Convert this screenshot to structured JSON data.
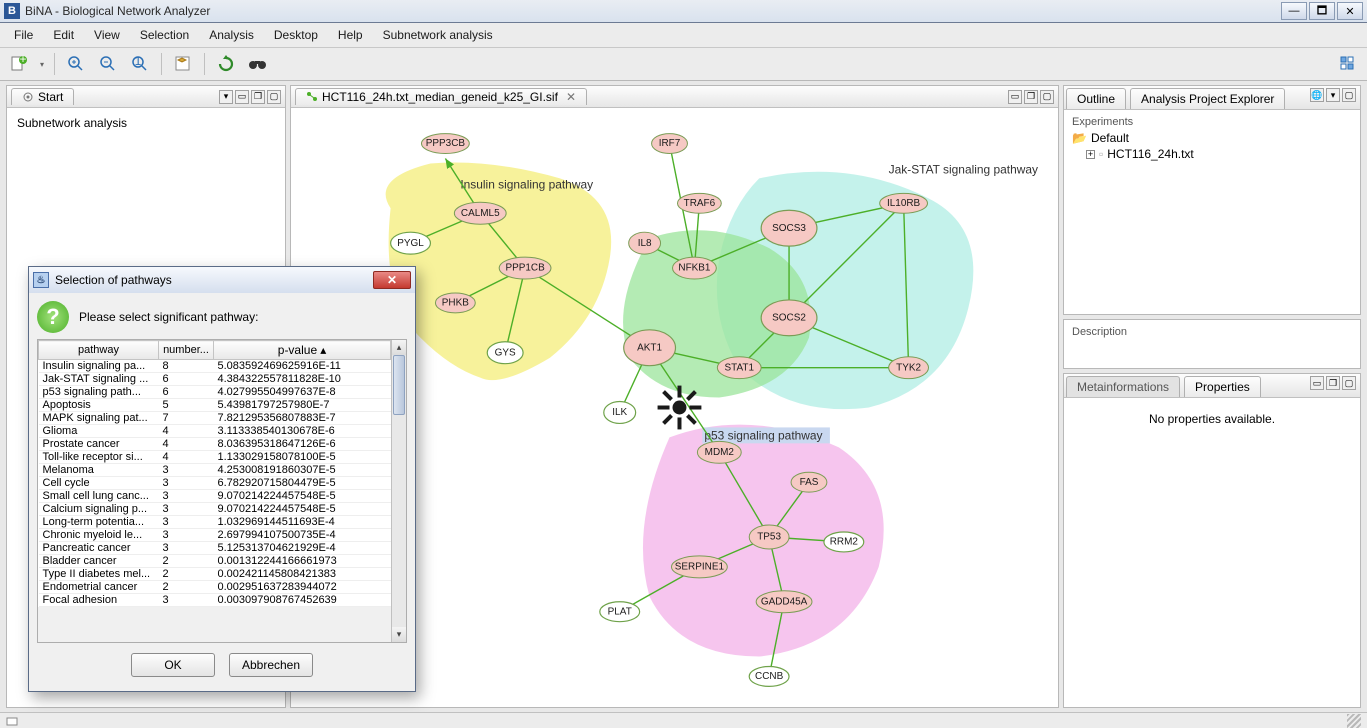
{
  "titlebar": {
    "app_title": "BiNA - Biological Network Analyzer",
    "icon_letter": "B"
  },
  "menu": [
    "File",
    "Edit",
    "View",
    "Selection",
    "Analysis",
    "Desktop",
    "Help",
    "Subnetwork analysis"
  ],
  "left_panel": {
    "tab": "Start",
    "body_text": "Subnetwork analysis"
  },
  "center": {
    "tab": "HCT116_24h.txt_median_geneid_k25_GI.sif",
    "clusters": {
      "insulin": "Insulin signaling pathway",
      "jakstat": "Jak-STAT signaling pathway",
      "p53": "p53 signaling pathway"
    },
    "nodes": [
      "PPP3CB",
      "IRF7",
      "CALML5",
      "PYGL",
      "TRAF6",
      "SOCS3",
      "IL10RB",
      "PPP1CB",
      "IL8",
      "NFKB1",
      "PHKB",
      "SOCS2",
      "GYS",
      "AKT1",
      "STAT1",
      "TYK2",
      "ILK",
      "MDM2",
      "FAS",
      "TP53",
      "RRM2",
      "SERPINE1",
      "GADD45A",
      "PLAT",
      "CCNB"
    ]
  },
  "right": {
    "tabs_top": [
      "Outline",
      "Analysis Project Explorer"
    ],
    "experiments_label": "Experiments",
    "tree": {
      "root": "Default",
      "child": "HCT116_24h.txt"
    },
    "description_label": "Description",
    "tabs_bottom": [
      "Metainformations",
      "Properties"
    ],
    "no_props": "No properties available."
  },
  "dialog": {
    "title": "Selection of pathways",
    "prompt": "Please select significant pathway:",
    "columns": [
      "pathway",
      "number...",
      "p-value"
    ],
    "rows": [
      {
        "pathway": "Insulin signaling pa...",
        "n": "8",
        "p": "5.083592469625916E-11"
      },
      {
        "pathway": "Jak-STAT signaling ...",
        "n": "6",
        "p": "4.384322557811828E-10"
      },
      {
        "pathway": "p53 signaling path...",
        "n": "6",
        "p": "4.027995504997637E-8"
      },
      {
        "pathway": "Apoptosis",
        "n": "5",
        "p": "5.43981797257980E-7"
      },
      {
        "pathway": "MAPK signaling pat...",
        "n": "7",
        "p": "7.821295356807883E-7"
      },
      {
        "pathway": "Glioma",
        "n": "4",
        "p": "3.113338540130678E-6"
      },
      {
        "pathway": "Prostate cancer",
        "n": "4",
        "p": "8.036395318647126E-6"
      },
      {
        "pathway": "Toll-like receptor si...",
        "n": "4",
        "p": "1.133029158078100E-5"
      },
      {
        "pathway": "Melanoma",
        "n": "3",
        "p": "4.253008191860307E-5"
      },
      {
        "pathway": "Cell cycle",
        "n": "3",
        "p": "6.782920715804479E-5"
      },
      {
        "pathway": "Small cell lung canc...",
        "n": "3",
        "p": "9.070214224457548E-5"
      },
      {
        "pathway": "Calcium signaling p...",
        "n": "3",
        "p": "9.070214224457548E-5"
      },
      {
        "pathway": "Long-term potentia...",
        "n": "3",
        "p": "1.032969144511693E-4"
      },
      {
        "pathway": "Chronic myeloid le...",
        "n": "3",
        "p": "2.697994107500735E-4"
      },
      {
        "pathway": "Pancreatic cancer",
        "n": "3",
        "p": "5.125313704621929E-4"
      },
      {
        "pathway": "Bladder cancer",
        "n": "2",
        "p": "0.001312244166661973"
      },
      {
        "pathway": "Type II diabetes mel...",
        "n": "2",
        "p": "0.002421145808421383"
      },
      {
        "pathway": "Endometrial cancer",
        "n": "2",
        "p": "0.002951637283944072"
      },
      {
        "pathway": "Focal adhesion",
        "n": "3",
        "p": "0.003097908767452639"
      }
    ],
    "ok": "OK",
    "cancel": "Abbrechen"
  }
}
